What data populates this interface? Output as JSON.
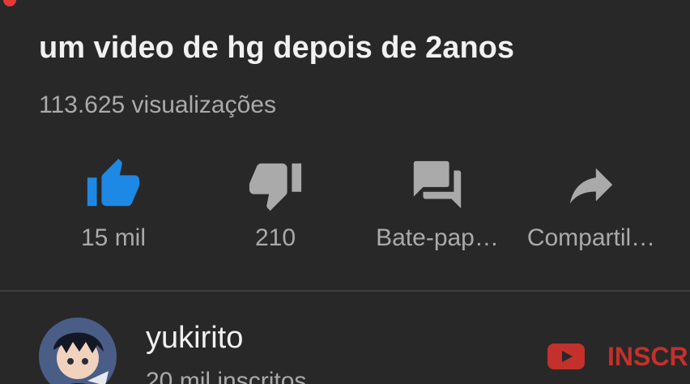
{
  "video": {
    "title": "um video de hg depois de 2anos",
    "views": "113.625 visualizações"
  },
  "actions": {
    "like": {
      "label": "15 mil",
      "icon": "thumb-up-icon",
      "color": "#1e88e5"
    },
    "dislike": {
      "label": "210",
      "icon": "thumb-down-icon"
    },
    "chat": {
      "label": "Bate-pap…",
      "icon": "chat-icon"
    },
    "share": {
      "label": "Compartil…",
      "icon": "share-icon"
    }
  },
  "channel": {
    "name": "yukirito",
    "subscribers": "20 mil inscritos",
    "subscribe_label": "INSCR",
    "subscribe_color": "#c4302b"
  }
}
